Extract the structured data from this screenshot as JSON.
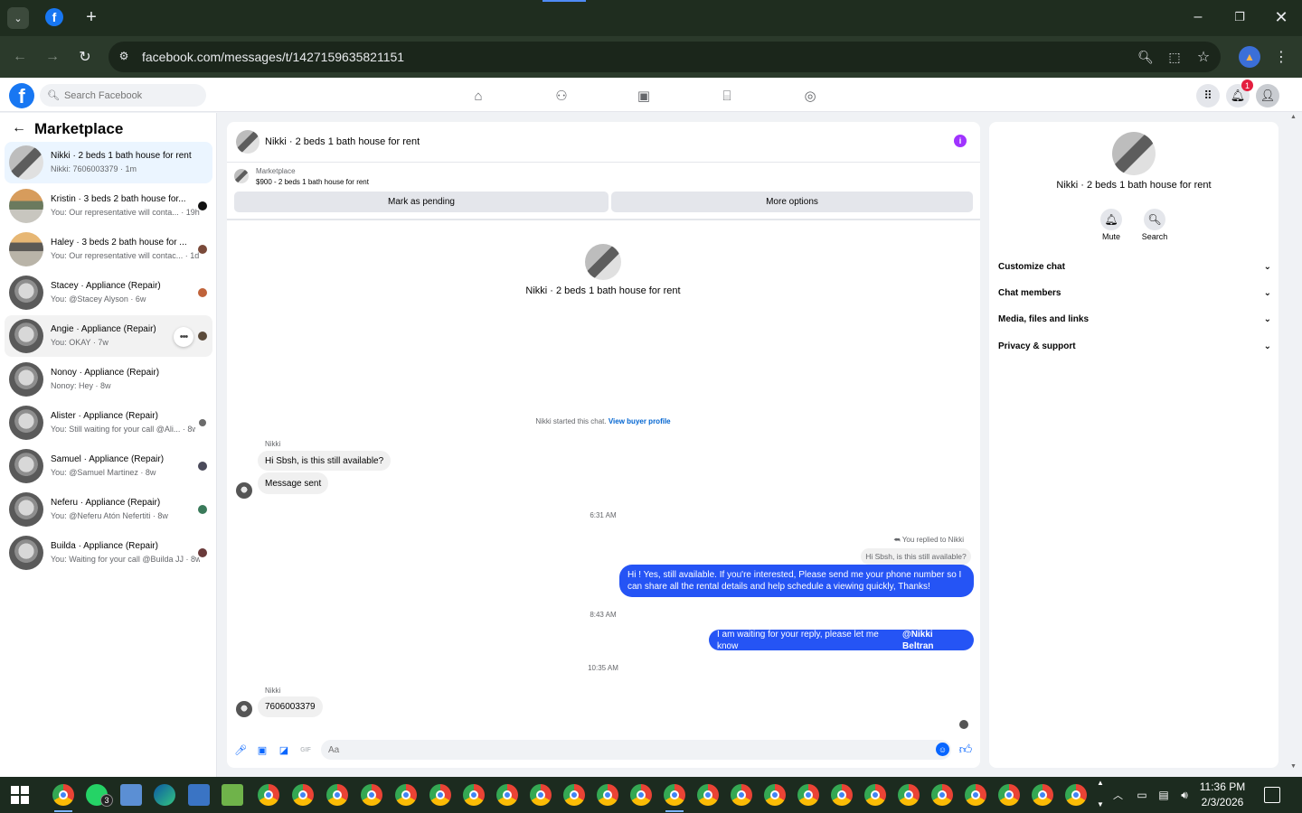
{
  "browser": {
    "url": "facebook.com/messages/t/1427159635821151",
    "icons": [
      "tab-list-icon",
      "facebook-favicon",
      "new-tab-icon",
      "minimize-icon",
      "restore-icon",
      "close-icon",
      "back-icon",
      "forward-icon",
      "reload-icon",
      "site-info-icon",
      "zoom-icon",
      "install-icon",
      "bookmark-star-icon",
      "profile-icon",
      "menu-icon"
    ]
  },
  "header": {
    "search_placeholder": "Search Facebook",
    "notification_count": "1",
    "nav_icons": [
      "home-icon",
      "friends-icon",
      "video-icon",
      "marketplace-icon",
      "groups-icon"
    ]
  },
  "sidebar": {
    "title": "Marketplace",
    "conversations": [
      {
        "name": "Nikki · 2 beds 1 bath house for rent",
        "preview": "Nikki: 7606003379 · 1m"
      },
      {
        "name": "Kristin · 3 beds 2 bath house for...",
        "preview": "You: Our representative will conta... · 19h"
      },
      {
        "name": "Haley · 3 beds 2 bath house for ...",
        "preview": "You: Our representative will contac... · 1d"
      },
      {
        "name": "Stacey · Appliance (Repair)",
        "preview": "You: @Stacey Alyson · 6w"
      },
      {
        "name": "Angie · Appliance (Repair)",
        "preview": "You: OKAY · 7w"
      },
      {
        "name": "Nonoy · Appliance (Repair)",
        "preview": "Nonoy: Hey · 8w"
      },
      {
        "name": "Alister · Appliance (Repair)",
        "preview": "You: Still waiting for your call @Ali... · 8w"
      },
      {
        "name": "Samuel · Appliance (Repair)",
        "preview": "You: @Samuel Martinez · 8w"
      },
      {
        "name": "Neferu · Appliance (Repair)",
        "preview": "You: @Neferu Atón Nefertiti · 8w"
      },
      {
        "name": "Builda · Appliance (Repair)",
        "preview": "You: Waiting for your call @Builda JJ · 8w"
      }
    ]
  },
  "chat": {
    "title": "Nikki · 2 beds 1 bath house for rent",
    "marketplace_label": "Marketplace",
    "listing": "$900 - 2 beds 1 bath house for rent",
    "mark_pending": "Mark as pending",
    "more_options": "More options",
    "center_name": "Nikki · 2 beds 1 bath house for rent",
    "started_text": "Nikki started this chat.",
    "view_buyer": "View buyer profile",
    "sender1": "Nikki",
    "msg1": "Hi Sbsh, is this still available?",
    "msg2": "Message sent",
    "time1": "6:31 AM",
    "replied_note": "You replied to Nikki",
    "quoted": "Hi Sbsh, is this still available?",
    "out1": "Hi ! Yes, still available. If you're interested, Please send me your phone number so I can share all the rental details and help schedule a viewing quickly, Thanks!",
    "time2": "8:43 AM",
    "out2_text": "I am waiting for your reply, please let me know",
    "out2_mention": "@Nikki Beltran",
    "time3": "10:35 AM",
    "sender2": "Nikki",
    "msg3": "7606003379",
    "composer_placeholder": "Aa"
  },
  "right_panel": {
    "name": "Nikki · 2 beds 1 bath house for rent",
    "mute": "Mute",
    "search": "Search",
    "sections": [
      "Customize chat",
      "Chat members",
      "Media, files and links",
      "Privacy & support"
    ]
  },
  "taskbar": {
    "whatsapp_badge": "3",
    "time": "11:36 PM",
    "date": "2/3/2026"
  },
  "colors": {
    "facebook_blue": "#1877f2",
    "outgoing_bubble": "#2554f5",
    "info_purple": "#a033ff",
    "notif_red": "#e41e3f"
  }
}
